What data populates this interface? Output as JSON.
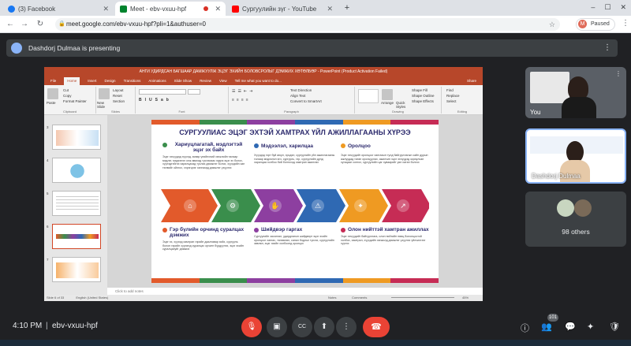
{
  "browser": {
    "tabs": [
      {
        "label": "(3) Facebook",
        "icon": "facebook-icon"
      },
      {
        "label": "Meet - ebv-vxuu-hpf",
        "icon": "meet-icon"
      },
      {
        "label": "Сургуулийн зүг - YouTube",
        "icon": "youtube-icon"
      }
    ],
    "new_tab": "+",
    "address": "meet.google.com/ebv-vxuu-hpf?pli=1&authuser=0",
    "profile_initial": "M",
    "profile_status": "Paused"
  },
  "meet": {
    "presenter_banner": "Dashdorj Dulmaa is presenting",
    "time": "4:10 PM",
    "meeting_code": "ebv-vxuu-hpf",
    "tiles": [
      {
        "label": "You"
      },
      {
        "label": "Dashdorj Dulmaa"
      },
      {
        "label": "98 others"
      }
    ],
    "participant_badge": "101"
  },
  "ppt": {
    "title": "АНГИ УДИРДСАН БАГШААР ДАМЖУУЛЖ ЭЦЭГ ЭХИЙН БОЛОВСРОЛЫГ ДЭМЖИХ ХӨТӨЛБӨР - PowerPoint (Product Activation Failed)",
    "menu": [
      "File",
      "Home",
      "Insert",
      "Design",
      "Transitions",
      "Animations",
      "Slide Show",
      "Review",
      "View",
      "Tell me what you want to do..."
    ],
    "active_menu": "Home",
    "ribbon": {
      "paste": "Paste",
      "cut": "Cut",
      "copy": "Copy",
      "format_painter": "Format Painter",
      "clipboard": "Clipboard",
      "new_slide": "New Slide",
      "layout": "Layout",
      "reset": "Reset",
      "section": "Section",
      "slides": "Slides",
      "font": "Font",
      "paragraph": "Paragraph",
      "text_direction": "Text Direction",
      "align_text": "Align Text",
      "convert_smartart": "Convert to SmartArt",
      "arrange": "Arrange",
      "quick_styles": "Quick Styles",
      "shape_fill": "Shape Fill",
      "shape_outline": "Shape Outline",
      "shape_effects": "Shape Effects",
      "drawing": "Drawing",
      "find": "Find",
      "replace": "Replace",
      "select": "Select",
      "editing": "Editing",
      "share": "Share"
    },
    "thumb_numbers": [
      "3",
      "4",
      "5",
      "6",
      "7"
    ],
    "notes_placeholder": "Click to add notes",
    "status_left": "Slide 6 of 33",
    "status_lang": "English (United States)",
    "status_notes": "Notes",
    "status_comments": "Comments",
    "zoom": "45%"
  },
  "slide": {
    "title": "СУРГУУЛИАС ЭЦЭГ ЭХТЭЙ ХАМТРАХ ҮЙЛ АЖИЛЛАГААНЫ ХҮРЭЭ",
    "colors": [
      "#e25a2b",
      "#3a8e4c",
      "#8d3fa0",
      "#2f69b3",
      "#ef9a22",
      "#c62c55"
    ],
    "top_items": [
      {
        "heading": "Хариуцлагатай, мэдлэгтэй эцэг эх байх",
        "body": "Эцэг эхчүүдэд хүүхэд, өсвөр үеийнхний хөгжлийн талаар мэдлэг, мэдээлэл олж авахад туслахаас гадна эцэг эх болох, хүүхэдтэйгээ харилцахад туслах дэмжлэг болох, хүүхдийн зан төлвийг ойлгох, хэрэгцээг хангахад дэмжлэг үзүүлэх"
      },
      {
        "heading": "Мэдээлэл, харилцаа",
        "body": "Хүүхдэд гэрт буй аюул, эрсдэл, сургуулийн үйл ажиллагааны талаар мэдээлэл өгч, сургууль, гэр, сургуулийн дунд харилцаа холбоо бий болгоход хамтран ажиллах"
      },
      {
        "heading": "Оролцоо",
        "body": "Эцэг эхчүүдийг оролцоог хангахын тулд байгууллагын сайн дурын ажлуудад татан оролцуулах, ажилчин эцэг эхчүүдэд зориулсан хугацааг сонгох, сургуулийн цаг хуваарийг уян хатан болгох"
      }
    ],
    "bottom_items": [
      {
        "heading": "Гэр бүлийн орчинд суралцах дэмжих",
        "body": "Эцэг эх, хүүхэд хамтран гэрийн даалгавар хийх, сургууль болон гэрийн хүрээнд суралцах орчинг бүрдүүлэх, эцэг эхийн суралцахуйг дэмжих"
      },
      {
        "heading": "Шийдвэр гаргах",
        "body": "Сургуулийн засаглал, удирдлагын шийдвэрт эцэг эхийн оролцоог хангах, төлөөлөл, санал бодлыг тусгах, сургуулийн зөвлөл, эцэг эхийн холбоонд оролцох"
      },
      {
        "heading": "Олон нийттэй хамтран ажиллах",
        "body": "Эцэг эхчүүдийг байгууллага, олон нийтийн нөөц бололцоотой холбох, хамтрал, хүүхдийн хөгжилд дэмжлэг үзүүлэх үйлчилгээг хүргэх"
      }
    ],
    "chevron_icons": [
      "home-icon",
      "gear-icon",
      "handshake-icon",
      "warning-icon",
      "lightbulb-icon",
      "growth-icon"
    ],
    "chevron_glyphs": [
      "⌂",
      "⚙",
      "✋",
      "⚠",
      "✦",
      "↗"
    ]
  }
}
